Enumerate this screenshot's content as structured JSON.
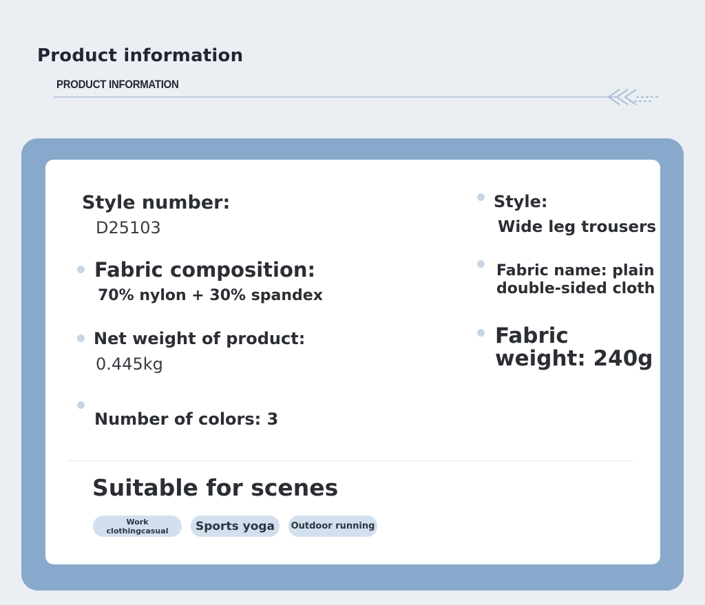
{
  "header": {
    "title": "Product information",
    "subtitle": "PRODUCT INFORMATION"
  },
  "fields": {
    "style_number": {
      "label": "Style number:",
      "value": "D25103"
    },
    "fabric_composition": {
      "label": "Fabric composition:",
      "value": "70% nylon + 30% spandex"
    },
    "net_weight": {
      "label": "Net weight of product:",
      "value": "0.445kg"
    },
    "number_of_colors": {
      "label": "Number of colors: 3"
    },
    "style": {
      "label": "Style:",
      "value": "Wide leg trousers"
    },
    "fabric_name": {
      "line1": "Fabric name: plain",
      "line2": "double-sided cloth"
    },
    "fabric_weight": {
      "line1": "Fabric",
      "line2": "weight: 240g"
    }
  },
  "scenes": {
    "title": "Suitable for scenes",
    "tags": [
      {
        "line1": "Work",
        "line2": "clothingcasual"
      },
      {
        "label": "Sports yoga"
      },
      {
        "label": "Outdoor running"
      }
    ]
  },
  "colors": {
    "background": "#ebeef2",
    "frame": "#88a9cc",
    "card": "#ffffff",
    "bullet": "#c6d6e4",
    "tag": "#d2e0ee",
    "header_line": "#a9bfd8"
  },
  "icons": {
    "header_decoration": "triple-chevron-left-icon",
    "bullet": "dot-icon"
  }
}
